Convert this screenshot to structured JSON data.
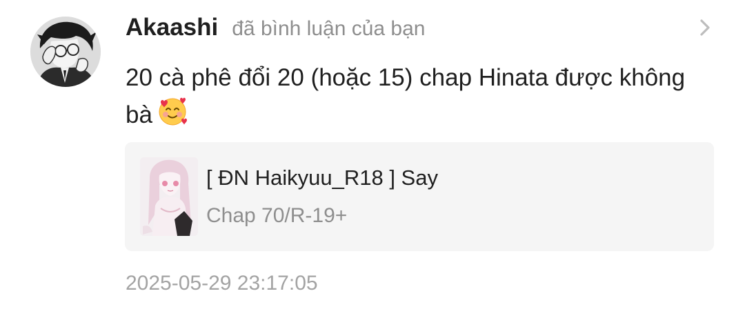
{
  "notification": {
    "username": "Akaashi",
    "action": "đã bình luận của bạn",
    "comment": "20 cà phê đổi 20 (hoặc 15) chap Hinata được không bà",
    "comment_emoji": "smiling-face-with-hearts-icon",
    "timestamp": "2025-05-29 23:17:05"
  },
  "story_card": {
    "title": "[ ĐN Haikyuu_R18 ] Say",
    "subtitle": "Chap 70/R-19+"
  },
  "colors": {
    "primary_text": "#1f1f1f",
    "secondary_text": "#8e8e8e",
    "card_background": "#f5f5f5",
    "chevron": "#bdbdbd"
  }
}
